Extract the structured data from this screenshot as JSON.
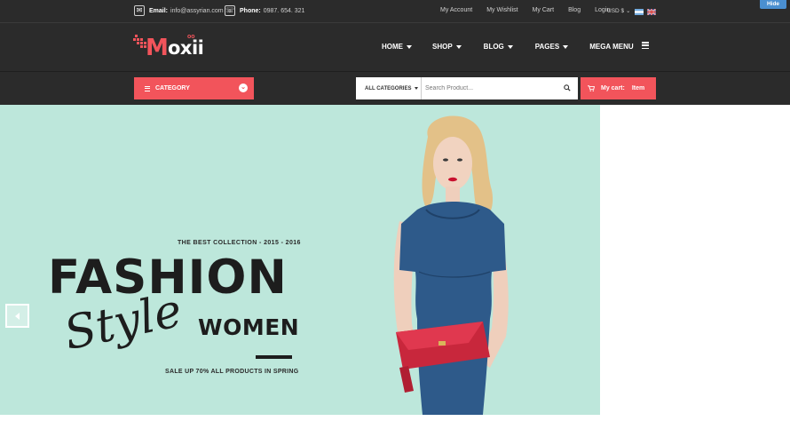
{
  "topbar": {
    "email_label": "Email:",
    "email_value": "info@assyrian.com",
    "phone_label": "Phone:",
    "phone_value": "0987. 654. 321",
    "links": [
      "My Account",
      "My Wishlist",
      "My Cart",
      "Blog",
      "Login"
    ],
    "currency": "USD $",
    "hide_label": "Hide"
  },
  "header": {
    "logo_m": "M",
    "logo_rest": "oxii",
    "logo_oo": "oo",
    "nav": [
      {
        "label": "HOME",
        "dropdown": true
      },
      {
        "label": "SHOP",
        "dropdown": true
      },
      {
        "label": "BLOG",
        "dropdown": true
      },
      {
        "label": "PAGES",
        "dropdown": true
      },
      {
        "label": "MEGA MENU",
        "dropdown": false
      }
    ]
  },
  "searchbar": {
    "category_label": "CATEGORY",
    "all_categories": "ALL CATEGORIES",
    "placeholder": "Search Product...",
    "cart_label": "My cart:",
    "cart_items": "Item"
  },
  "hero": {
    "best_collection": "THE BEST COLLECTION - 2015 - 2016",
    "fashion": "FASHION",
    "style": "Style",
    "women": "WOMEN",
    "sale": "SALE UP 70% ALL PRODUCTS IN SPRING"
  },
  "colors": {
    "accent": "#f2545b",
    "dark": "#2b2b2b",
    "hero_bg": "#bde7db"
  }
}
